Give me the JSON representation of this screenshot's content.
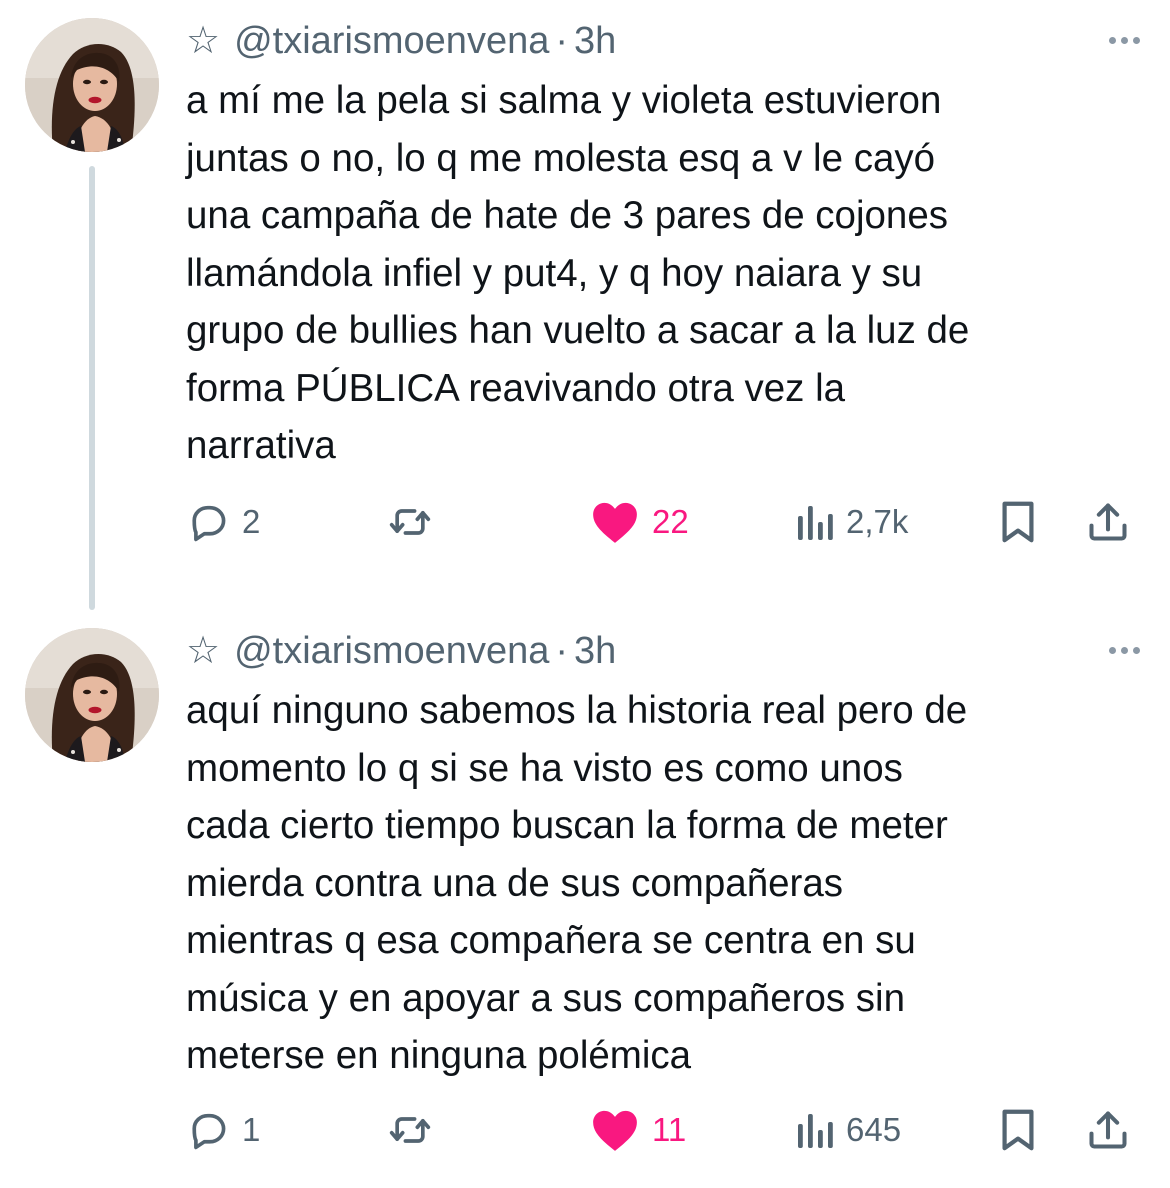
{
  "tweets": [
    {
      "star_glyph": "☆",
      "handle": "@txiarismoenvena",
      "separator": "·",
      "time": "3h",
      "text_lines": [
        "a mí me la pela si salma y violeta estuvieron",
        "juntas o no, lo q me molesta esq a v le cayó",
        "una campaña de hate de 3 pares de cojones",
        "llamándola infiel y put4, y q hoy naiara y su",
        "grupo de bullies han vuelto a sacar a la luz de",
        "forma PÚBLICA reavivando otra vez la",
        "narrativa"
      ],
      "replies": "2",
      "retweets": "",
      "likes": "22",
      "liked": true,
      "views": "2,7k"
    },
    {
      "star_glyph": "☆",
      "handle": "@txiarismoenvena",
      "separator": "·",
      "time": "3h",
      "text_lines": [
        "aquí ninguno sabemos la historia real pero de",
        "momento lo q si se ha visto es como unos",
        "cada cierto tiempo buscan la forma de meter",
        "mierda contra una de sus compañeras",
        "mientras q esa compañera se centra en su",
        "música y en apoyar a sus compañeros sin",
        "meterse en ninguna polémica"
      ],
      "replies": "1",
      "retweets": "",
      "likes": "11",
      "liked": true,
      "views": "645"
    }
  ],
  "colors": {
    "text": "#0f1419",
    "secondary": "#536471",
    "like": "#f91880",
    "thread_line": "#cfd9de"
  },
  "icons": [
    "star-icon",
    "more-icon",
    "reply-icon",
    "retweet-icon",
    "heart-icon",
    "views-icon",
    "bookmark-icon",
    "share-icon"
  ]
}
